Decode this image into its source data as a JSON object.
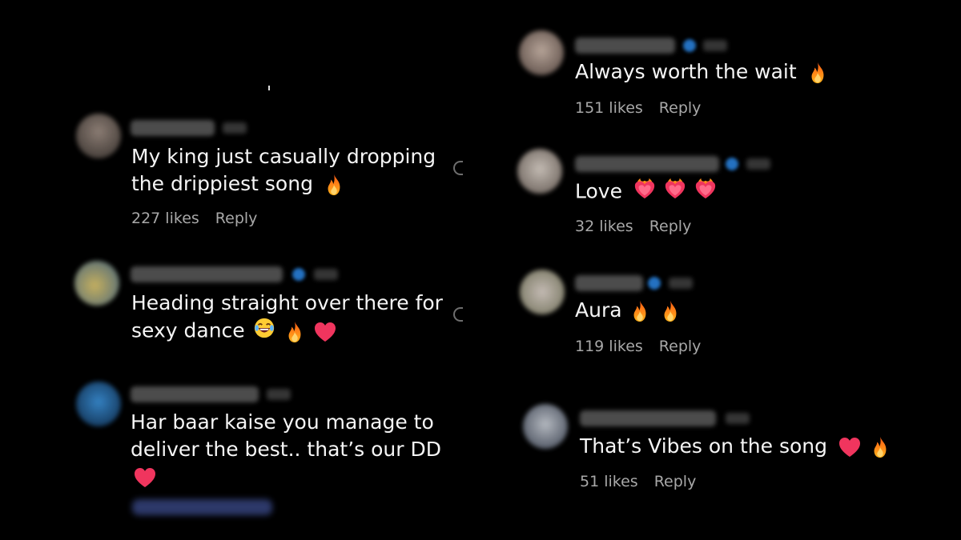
{
  "comments_left": [
    {
      "text_lines": [
        "My king just casually dropping",
        "the drippiest song"
      ],
      "emojis": [
        "fire"
      ],
      "likes": "227 likes",
      "reply": "Reply"
    },
    {
      "text_lines": [
        "Heading straight over there for",
        "sexy dance"
      ],
      "emojis": [
        "laughing-face",
        "fire",
        "heart"
      ],
      "likes": null,
      "reply": null
    },
    {
      "text_lines": [
        "Har baar kaise you manage to",
        "deliver the best.. that’s our DD"
      ],
      "emojis": [
        "heart"
      ],
      "likes": null,
      "reply": null
    }
  ],
  "comments_right": [
    {
      "text_lines": [
        "Always worth the wait"
      ],
      "emojis": [
        "fire"
      ],
      "likes": "151 likes",
      "reply": "Reply"
    },
    {
      "text_lines": [
        "Love"
      ],
      "emojis": [
        "heart-on-fire",
        "heart-on-fire",
        "heart-on-fire"
      ],
      "likes": "32 likes",
      "reply": "Reply"
    },
    {
      "text_lines": [
        "Aura"
      ],
      "emojis": [
        "fire",
        "fire"
      ],
      "likes": "119 likes",
      "reply": "Reply"
    },
    {
      "text_lines": [
        "That’s Vibes on the song"
      ],
      "emojis": [
        "heart",
        "fire"
      ],
      "likes": "51 likes",
      "reply": "Reply"
    }
  ],
  "icons": {
    "fire": "fire-icon",
    "heart": "heart-icon",
    "laughing": "laughing-face-icon",
    "heart_on_fire": "heart-on-fire-icon"
  },
  "colors": {
    "background": "#000000",
    "text": "#f5f5f5",
    "meta": "#a8a8a8",
    "verified": "#2d8ef2",
    "heart": "#f0355e",
    "fire": "#ff7a1a"
  }
}
